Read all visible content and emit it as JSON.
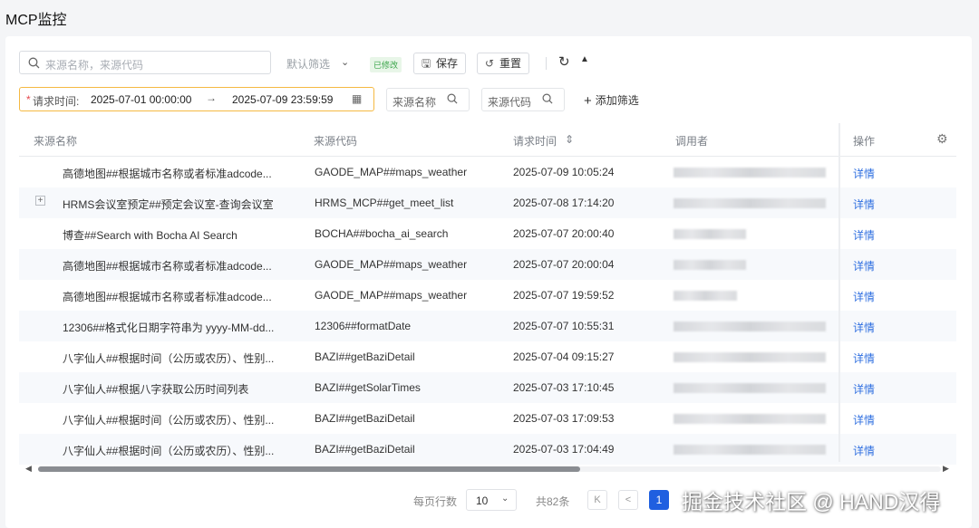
{
  "page": {
    "title": "MCP监控"
  },
  "toolbar": {
    "search_placeholder": "来源名称，来源代码",
    "default_filter": "默认筛选",
    "modified_badge": "已修改",
    "save_label": "保存",
    "reset_label": "重置"
  },
  "filters": {
    "request_time_label": "请求时间:",
    "start": "2025-07-01 00:00:00",
    "end": "2025-07-09 23:59:59",
    "source_name": "来源名称",
    "source_code": "来源代码",
    "add_filter": "添加筛选"
  },
  "table": {
    "columns": [
      "来源名称",
      "来源代码",
      "请求时间",
      "调用者",
      "操作"
    ],
    "detail_label": "详情",
    "rows": [
      {
        "name": "高德地图##根据城市名称或者标准adcode...",
        "code": "GAODE_MAP##maps_weather",
        "time": "2025-07-09 10:05:24"
      },
      {
        "name": "HRMS会议室预定##预定会议室-查询会议室",
        "code": "HRMS_MCP##get_meet_list",
        "time": "2025-07-08 17:14:20"
      },
      {
        "name": "博查##Search with Bocha AI Search",
        "code": "BOCHA##bocha_ai_search",
        "time": "2025-07-07 20:00:40"
      },
      {
        "name": "高德地图##根据城市名称或者标准adcode...",
        "code": "GAODE_MAP##maps_weather",
        "time": "2025-07-07 20:00:04"
      },
      {
        "name": "高德地图##根据城市名称或者标准adcode...",
        "code": "GAODE_MAP##maps_weather",
        "time": "2025-07-07 19:59:52"
      },
      {
        "name": "12306##格式化日期字符串为 yyyy-MM-dd...",
        "code": "12306##formatDate",
        "time": "2025-07-07 10:55:31"
      },
      {
        "name": "八字仙人##根据时间（公历或农历）、性别...",
        "code": "BAZI##getBaziDetail",
        "time": "2025-07-04 09:15:27"
      },
      {
        "name": "八字仙人##根据八字获取公历时间列表",
        "code": "BAZI##getSolarTimes",
        "time": "2025-07-03 17:10:45"
      },
      {
        "name": "八字仙人##根据时间（公历或农历）、性别...",
        "code": "BAZI##getBaziDetail",
        "time": "2025-07-03 17:09:53"
      },
      {
        "name": "八字仙人##根据时间（公历或农历）、性别...",
        "code": "BAZI##getBaziDetail",
        "time": "2025-07-03 17:04:49"
      }
    ]
  },
  "pagination": {
    "rows_per_page_label": "每页行数",
    "page_size": "10",
    "total": "共82条",
    "first": "K",
    "prev": "<",
    "current_page": "1"
  },
  "watermark": "掘金技术社区 @ HAND汉得",
  "colors": {
    "accent": "#1f5fe0",
    "link": "#2f6fe0",
    "highlight_border": "#f5b942",
    "modified": "#3aa54a"
  }
}
